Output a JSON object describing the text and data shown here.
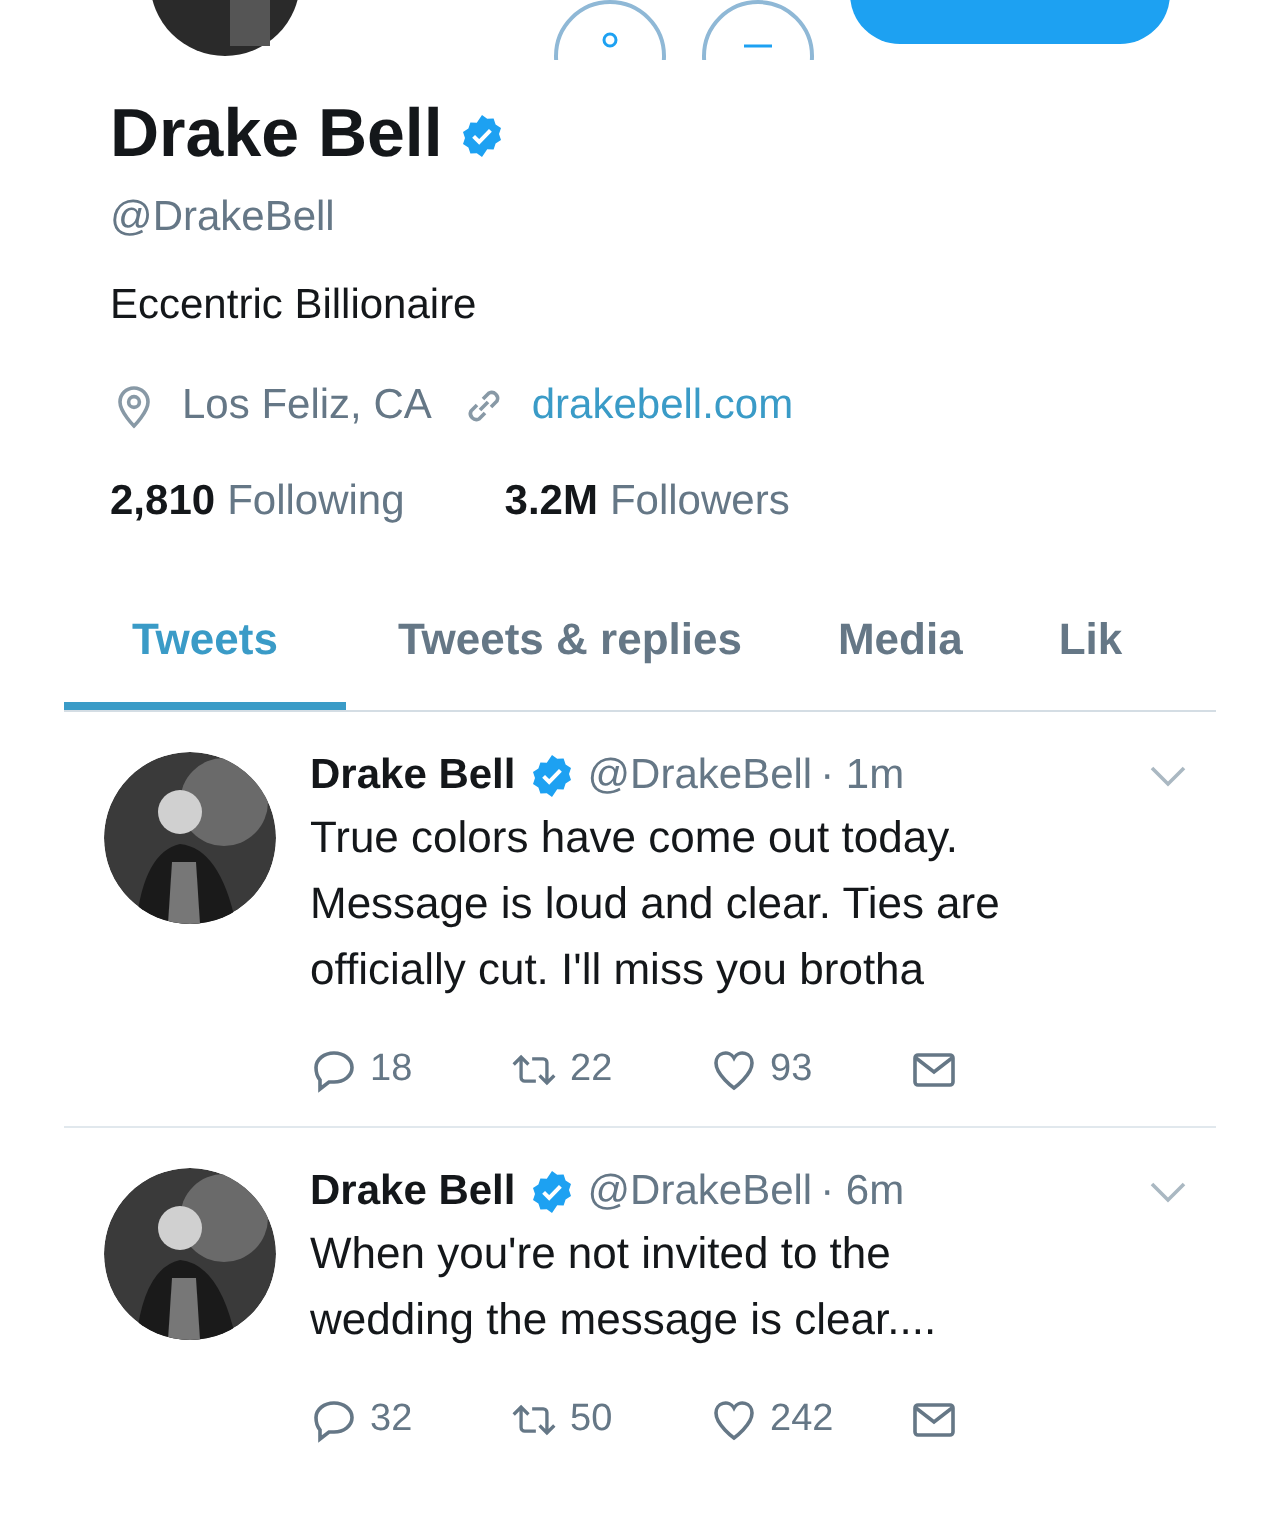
{
  "profile": {
    "name": "Drake Bell",
    "verified": true,
    "handle": "@DrakeBell",
    "bio": "Eccentric Billionaire",
    "location": "Los Feliz, CA",
    "website": "drakebell.com",
    "following_count": "2,810",
    "following_label": "Following",
    "followers_count": "3.2M",
    "followers_label": "Followers"
  },
  "tabs": [
    {
      "label": "Tweets",
      "selected": true
    },
    {
      "label": "Tweets & replies",
      "selected": false
    },
    {
      "label": "Media",
      "selected": false
    },
    {
      "label": "Lik",
      "selected": false
    }
  ],
  "tweets": [
    {
      "name": "Drake Bell",
      "verified": true,
      "handle": "@DrakeBell",
      "time": "· 1m",
      "text": "True colors have come out today. Message is loud and clear. Ties are officially cut. I'll miss you brotha",
      "replies": "18",
      "retweets": "22",
      "likes": "93"
    },
    {
      "name": "Drake Bell",
      "verified": true,
      "handle": "@DrakeBell",
      "time": "· 6m",
      "text": "When you're not invited to the wedding the message is clear....",
      "replies": "32",
      "retweets": "50",
      "likes": "242"
    }
  ]
}
